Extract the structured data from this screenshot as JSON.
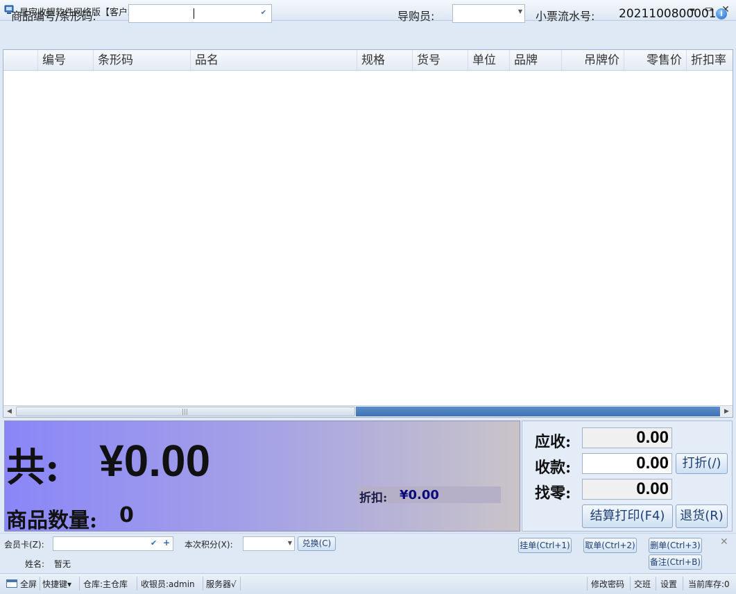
{
  "window": {
    "title": "星宇收银软件网络版【客户端】(注册版) V2.62--收银台",
    "min_glyph": "▬",
    "max_glyph": "▭",
    "close_glyph": "✕"
  },
  "toolbar": {
    "code_label": "商品编号/条形码:",
    "code_value": "",
    "guide_label": "导购员:",
    "guide_value": "",
    "receipt_label": "小票流水号:",
    "receipt_no": "2021100800001",
    "help_glyph": "i"
  },
  "grid": {
    "columns": [
      "",
      "编号",
      "条形码",
      "品名",
      "规格",
      "货号",
      "单位",
      "品牌",
      "吊牌价",
      "零售价",
      "折扣率"
    ],
    "rows": []
  },
  "totals": {
    "total_label": "共:",
    "total_amount": "¥0.00",
    "qty_label": "商品数量:",
    "qty_value": "0",
    "discount_label": "折扣:",
    "discount_value": "¥0.00"
  },
  "payment": {
    "due_label": "应收:",
    "due_value": "0.00",
    "received_label": "收款:",
    "received_value": "0.00",
    "change_label": "找零:",
    "change_value": "0.00",
    "discount_button": "打折(/)",
    "settle_button": "结算打印(F4)",
    "return_button": "退货(R)"
  },
  "member": {
    "card_label": "会员卡(Z):",
    "card_value": "",
    "points_label": "本次积分(X):",
    "points_value": "",
    "exchange_button": "兑换(C)",
    "name_label": "姓名:",
    "name_value": "暂无",
    "hold_button": "挂单(Ctrl+1)",
    "fetch_button": "取单(Ctrl+2)",
    "delete_button": "删单(Ctrl+3)",
    "note_button": "备注(Ctrl+B)"
  },
  "status": {
    "fullscreen": "全屏",
    "shortcuts": "快捷键▾",
    "warehouse": "仓库:主仓库",
    "cashier": "收银员:admin",
    "server": "服务器√",
    "change_password": "修改密码",
    "shift": "交班",
    "settings": "设置",
    "stock": "当前库存:0"
  }
}
